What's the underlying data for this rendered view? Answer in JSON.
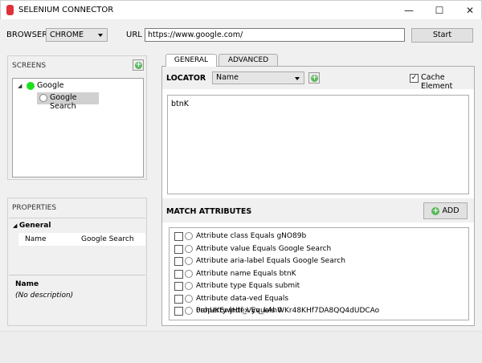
{
  "window": {
    "title": "SELENIUM CONNECTOR",
    "minimize": "—",
    "maximize": "☐",
    "close": "✕"
  },
  "toolbar": {
    "browser_label": "BROWSER",
    "browser_value": "CHROME",
    "url_label": "URL",
    "url_value": "https://www.google.com/",
    "start_label": "Start"
  },
  "screens": {
    "header": "SCREENS",
    "tree": [
      {
        "label": "Google",
        "children": [
          {
            "label": "Google Search"
          }
        ]
      }
    ]
  },
  "properties": {
    "header": "PROPERTIES",
    "group": "General",
    "rows": [
      {
        "name": "Name",
        "value": "Google Search"
      }
    ],
    "desc_title": "Name",
    "desc_text": "(No description)"
  },
  "tabs": [
    {
      "label": "GENERAL"
    },
    {
      "label": "ADVANCED"
    }
  ],
  "locator": {
    "label": "LOCATOR",
    "value": "Name",
    "cache_label": "Cache Element",
    "cache_checked": true,
    "text": "btnK"
  },
  "match": {
    "header": "MATCH ATTRIBUTES",
    "add_label": "ADD",
    "items": [
      "Attribute class Equals gNO89b",
      "Attribute value Equals Google Search",
      "Attribute aria-label Equals Google Search",
      "Attribute name Equals btnK",
      "Attribute type Equals submit",
      "Attribute data-ved Equals 0ahUKEwjHtf_Vyv_kAhWKr48KHf7DA8QQ4dUDCAo",
      "Property Index Equals 0"
    ]
  }
}
